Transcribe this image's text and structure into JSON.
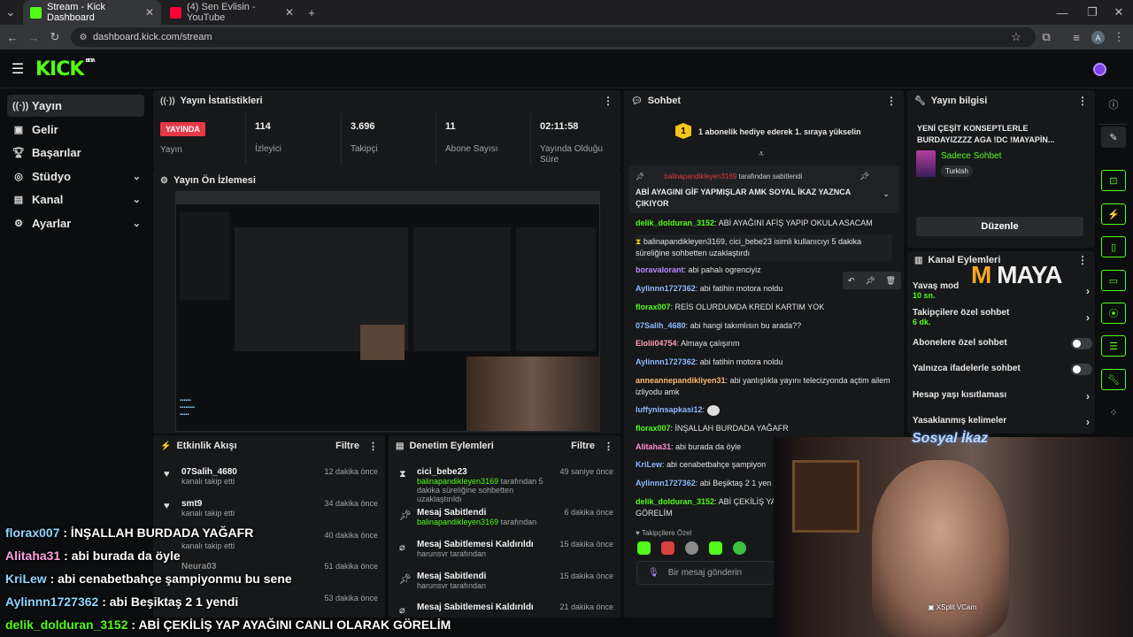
{
  "browser": {
    "tabs": [
      {
        "title": "Stream - Kick Dashboard",
        "active": true
      },
      {
        "title": "(4) Sen Evlisin - YouTube",
        "active": false
      }
    ],
    "url": "dashboard.kick.com/stream",
    "profile_initial": "A"
  },
  "brand": {
    "logo": "KICK",
    "beta": "BETA",
    "accent": "#53fc18"
  },
  "sidebar": {
    "items": [
      {
        "label": "Yayın",
        "icon": "broadcast-icon",
        "active": true
      },
      {
        "label": "Gelir",
        "icon": "dollar-icon"
      },
      {
        "label": "Başarılar",
        "icon": "trophy-icon"
      },
      {
        "label": "Stüdyo",
        "icon": "gauge-icon",
        "expandable": true
      },
      {
        "label": "Kanal",
        "icon": "list-icon",
        "expandable": true
      },
      {
        "label": "Ayarlar",
        "icon": "gear-icon",
        "expandable": true
      }
    ]
  },
  "stats": {
    "title": "Yayın İstatistikleri",
    "live_badge": "YAYINDA",
    "live_label": "Yayın",
    "viewers": {
      "value": "114",
      "label": "İzleyici"
    },
    "followers": {
      "value": "3.696",
      "label": "Takipçi"
    },
    "subs": {
      "value": "11",
      "label": "Abone Sayısı"
    },
    "duration": {
      "value": "02:11:58",
      "label": "Yayında Olduğu Süre"
    }
  },
  "preview": {
    "title": "Yayın Ön İzlemesi"
  },
  "activity": {
    "title": "Etkinlik Akışı",
    "filter": "Filtre",
    "items": [
      {
        "name": "07Salih_4680",
        "sub": "kanalı takip etti",
        "time": "12 dakika önce"
      },
      {
        "name": "smt9",
        "sub": "kanalı takip etti",
        "time": "34 dakika önce"
      },
      {
        "name": "",
        "sub": "kanalı takip etti",
        "time": "40 dakika önce"
      },
      {
        "name": "Neura03",
        "sub": "",
        "time": "51 dakika önce"
      },
      {
        "name": "",
        "sub": "",
        "time": "53 dakika önce"
      }
    ]
  },
  "moderation": {
    "title": "Denetim Eylemleri",
    "filter": "Filtre",
    "items": [
      {
        "name": "cici_bebe23",
        "user": "balinapandikleyen3169",
        "sub": " tarafından 5 dakika süreliğine sohbetten uzaklaştırıldı",
        "time": "49 saniye önce",
        "icon": "hourglass-icon"
      },
      {
        "name": "Mesaj Sabitlendi",
        "user": "balinapandikleyen3169",
        "sub": " tarafından",
        "time": "6 dakika önce",
        "icon": "pin-icon"
      },
      {
        "name": "Mesaj Sabitlemesi Kaldırıldı",
        "user": "",
        "sub": "harunsvr tarafından",
        "time": "15 dakika önce",
        "icon": "unpin-icon"
      },
      {
        "name": "Mesaj Sabitlendi",
        "user": "",
        "sub": "harunsvr tarafından",
        "time": "15 dakika önce",
        "icon": "pin-icon"
      },
      {
        "name": "Mesaj Sabitlemesi Kaldırıldı",
        "user": "",
        "sub": "",
        "time": "21 dakika önce",
        "icon": "unpin-icon"
      }
    ]
  },
  "chat": {
    "title": "Sohbet",
    "gift_banner": "1 abonelik hediye ederek 1. sıraya yükselin",
    "gift_rank": "1",
    "pinned": {
      "user": "balinapandikleyen3169",
      "suffix": "tarafından sabitlendi",
      "text": "ABİ AYAGINI GİF YAPMIŞLAR AMK SOYAL İKAZ YAZNCA ÇIKIYOR"
    },
    "messages": [
      {
        "user": "delik_dolduran_3152",
        "color": "#53fc18",
        "text": "ABİ AYAĞINI AFİŞ YAPIP OKULA ASACAM"
      },
      {
        "user": "",
        "color": "#e2e2e2",
        "text": "balinapandikleyen3169, cici_bebe23 isimli kullanıcıyı 5 dakika süreliğine sohbetten uzaklaştırdı",
        "system": true
      },
      {
        "user": "boravalorant",
        "color": "#b78bff",
        "text": "abi pahalı ogrenciyiz"
      },
      {
        "user": "Aylinnn1727362",
        "color": "#8fb8ff",
        "text": "abi fatihin motora noldu"
      },
      {
        "user": "florax007",
        "color": "#53fc18",
        "text": "REİS OLURDUMDA KREDİ KARTIM YOK"
      },
      {
        "user": "07Salih_4680",
        "color": "#8fb8ff",
        "text": "abi hangi takımlısın bu arada??"
      },
      {
        "user": "Elolii04754",
        "color": "#ff9fb3",
        "text": "Almaya çalışırım"
      },
      {
        "user": "Aylinnn1727362",
        "color": "#8fb8ff",
        "text": "abi fatihin motora noldu"
      },
      {
        "user": "anneannepandikliyen31",
        "color": "#ffb86b",
        "text": "abi yanlışlıkla yayını telecizyonda açtim ailem izliyodu amk"
      },
      {
        "user": "luffyninsapkasi12",
        "color": "#8fb8ff",
        "text": ""
      },
      {
        "user": "florax007",
        "color": "#53fc18",
        "text": "İNŞALLAH BURDADA YAĞAFR"
      },
      {
        "user": "Alitaha31",
        "color": "#ff8fd1",
        "text": "abi burada da öyle"
      },
      {
        "user": "KriLew",
        "color": "#8fb8ff",
        "text": "abi cenabetbahçe şampiyon"
      },
      {
        "user": "Aylinnn1727362",
        "color": "#8fb8ff",
        "text": "abi Beşiktaş 2 1 yen"
      },
      {
        "user": "delik_dolduran_3152",
        "color": "#53fc18",
        "text": "ABİ ÇEKİLİŞ YA GÖRELİM"
      }
    ],
    "followers_only_label": "Takipçilere Özel",
    "input_placeholder": "Bir mesaj gönderin"
  },
  "stream_info": {
    "title": "Yayın bilgisi",
    "stream_title": "YENİ ÇEŞİT KONSEPTLERLE BURDAYIZZZZ AGA !DC !MAYAPİN...",
    "category": "Sadece Sohbet",
    "language": "Turkish",
    "edit_button": "Düzenle"
  },
  "channel_actions": {
    "title": "Kanal Eylemleri",
    "items": [
      {
        "label": "Yavaş mod",
        "sub": "10 sn.",
        "type": "arrow"
      },
      {
        "label": "Takipçilere özel sohbet",
        "sub": "6 dk.",
        "type": "arrow"
      },
      {
        "label": "Abonelere özel sohbet",
        "sub": "",
        "type": "toggle"
      },
      {
        "label": "Yalnızca ifadelerle sohbet",
        "sub": "",
        "type": "toggle"
      },
      {
        "label": "Hesap yaşı kısıtlaması",
        "sub": "",
        "type": "arrow"
      },
      {
        "label": "Yasaklanmış kelimeler",
        "sub": "",
        "type": "arrow"
      }
    ]
  },
  "overlay": {
    "sponsor": "MAYA",
    "webcam_label": "Sosyal İkaz",
    "webcam_brand": "XSplit VCam",
    "chat": [
      {
        "user": "florax007",
        "text": " : İNŞALLAH BURDADA YAĞAFR"
      },
      {
        "user": "Alitaha31",
        "text": " : abi burada da öyle"
      },
      {
        "user": "KriLew",
        "text": " : abi cenabetbahçe şampiyonmu bu sene"
      },
      {
        "user": "Aylinnn1727362",
        "text": " : abi Beşiktaş 2 1 yendi"
      },
      {
        "user": "delik_dolduran_3152",
        "text": " : ABİ ÇEKİLİŞ YAP AYAĞINI CANLI OLARAK GÖRELİM"
      }
    ]
  }
}
